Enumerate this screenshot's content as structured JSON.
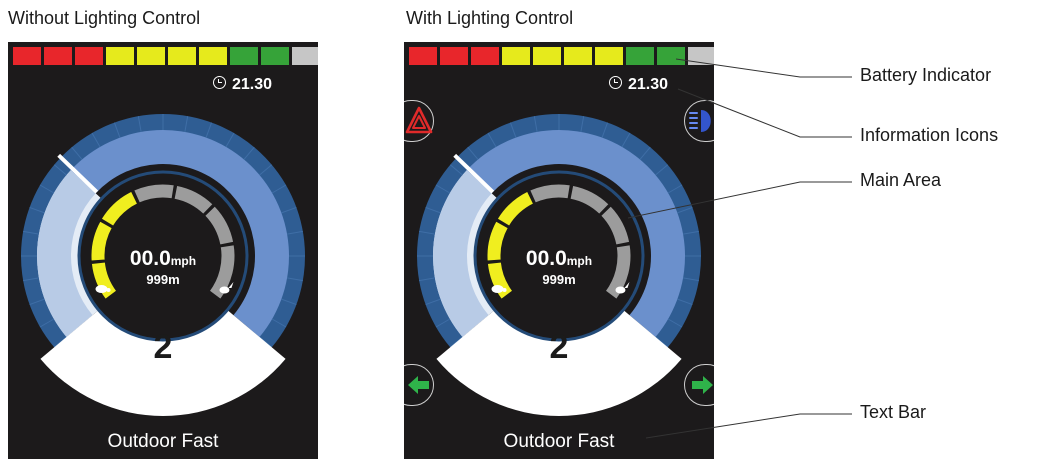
{
  "left_panel": {
    "title": "Without Lighting Control",
    "time": "21.30",
    "speed_value": "00.0",
    "speed_unit": "mph",
    "distance": "999m",
    "profile_number": "2",
    "profile_name": "Outdoor Fast"
  },
  "right_panel": {
    "title": "With Lighting Control",
    "time": "21.30",
    "speed_value": "00.0",
    "speed_unit": "mph",
    "distance": "999m",
    "profile_number": "2",
    "profile_name": "Outdoor Fast"
  },
  "battery_segments": [
    "#e8262b",
    "#e8262b",
    "#e8262b",
    "#e6ea1c",
    "#e6ea1c",
    "#e6ea1c",
    "#e6ea1c",
    "#36a339",
    "#36a339",
    "#c6c6c6"
  ],
  "icons": {
    "hazard": "warning-triangle-icon",
    "headlight": "headlight-icon",
    "left_indicator": "left-arrow-icon",
    "right_indicator": "right-arrow-icon",
    "clock": "clock-icon",
    "turtle": "turtle-icon",
    "rabbit": "rabbit-icon"
  },
  "colors": {
    "screen_bg": "#1c1a1b",
    "dial_blue": "#6b90cc",
    "dial_light_blue": "#b8cbe6",
    "dial_pale": "#e4ecf6",
    "dial_track": "#2f5d93",
    "speed_yellow": "#f0ee1f",
    "speed_grey": "#9c9c9c",
    "hazard_red": "#e02a2a",
    "indicator_green": "#2fb34a",
    "headlight_blue": "#3355cc"
  },
  "callouts": [
    "Battery Indicator",
    "Information Icons",
    "Main Area",
    "Text Bar"
  ]
}
